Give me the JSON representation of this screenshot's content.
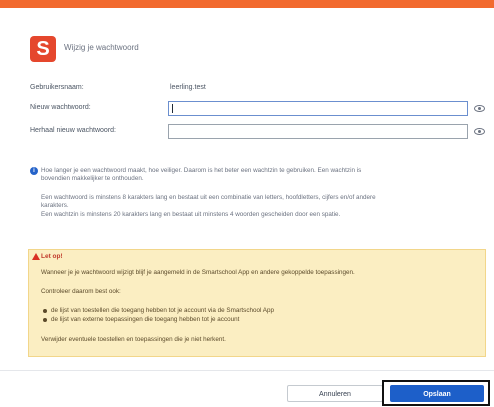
{
  "dialog": {
    "title": "Wijzig je wachtwoord",
    "logo_letter": "S"
  },
  "form": {
    "username_label": "Gebruikersnaam:",
    "username_value": "leerling.test",
    "new_password_label": "Nieuw wachtwoord:",
    "new_password_value": "",
    "repeat_password_label": "Herhaal nieuw wachtwoord:",
    "repeat_password_value": ""
  },
  "info": {
    "line1": "Hoe langer je een wachtwoord maakt, hoe veiliger. Daarom is het beter een wachtzin te gebruiken. Een wachtzin is",
    "line2": "bovendien makkelijker te onthouden.",
    "line3": "Een wachtwoord is minstens 8 karakters lang en bestaat uit een combinatie van letters, hoofdletters, cijfers en/of andere",
    "line4": "karakters.",
    "line5": "Een wachtzin is minstens 20 karakters lang en bestaat uit minstens 4 woorden gescheiden door een spatie."
  },
  "warning": {
    "title": "Let op!",
    "text1": "Wanneer je je wachtwoord wijzigt blijf je aangemeld in de Smartschool App en andere gekoppelde toepassingen.",
    "text2": "Controleer daarom best ook:",
    "bullets": [
      "de lijst van toestellen die toegang hebben tot je account via de Smartschool App",
      "de lijst van externe toepassingen die toegang hebben tot je account"
    ],
    "text3": "Verwijder eventuele toestellen en toepassingen die je niet herkent."
  },
  "buttons": {
    "cancel": "Annuleren",
    "save": "Opslaan"
  },
  "colors": {
    "accent_bar": "#f26a2e",
    "logo": "#e5472d",
    "primary_button": "#1d5fc9",
    "warning_bg": "#fbeec2"
  }
}
